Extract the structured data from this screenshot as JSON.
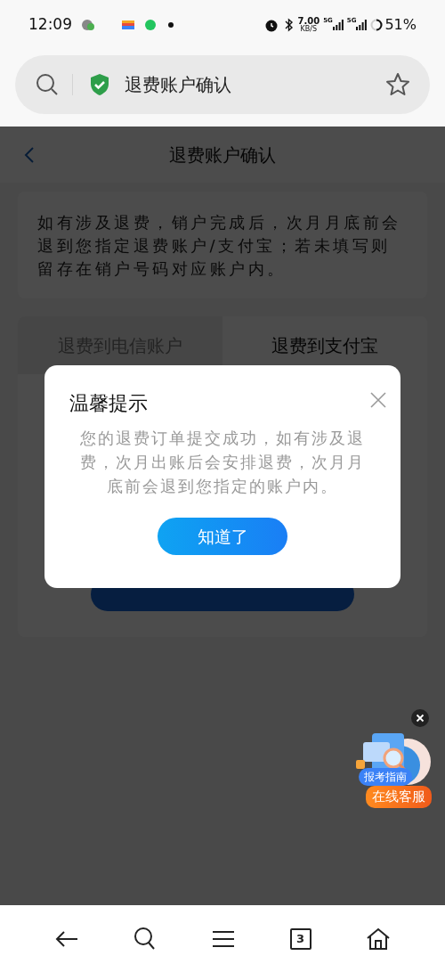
{
  "status_bar": {
    "time": "12:09",
    "net_speed": "7.00",
    "net_unit": "KB/S",
    "signals": [
      "5G",
      "5G"
    ],
    "battery": "51%"
  },
  "address_bar": {
    "title": "退费账户确认"
  },
  "header": {
    "title": "退费账户确认"
  },
  "notice": "如有涉及退费，销户完成后，次月月底前会退到您指定退费账户/支付宝；若未填写则留存在销户号码对应账户内。",
  "tabs": [
    {
      "label": "退费到电信账户",
      "selected": false
    },
    {
      "label": "退费到支付宝",
      "selected": true
    }
  ],
  "dialog": {
    "title": "温馨提示",
    "message": "您的退费订单提交成功，如有涉及退费，次月出账后会安排退费，次月月底前会退到您指定的账户内。",
    "button": "知道了"
  },
  "float_widget": {
    "guide": "报考指南",
    "service": "在线客服"
  },
  "bottom_nav": {
    "tab_count": "3"
  }
}
